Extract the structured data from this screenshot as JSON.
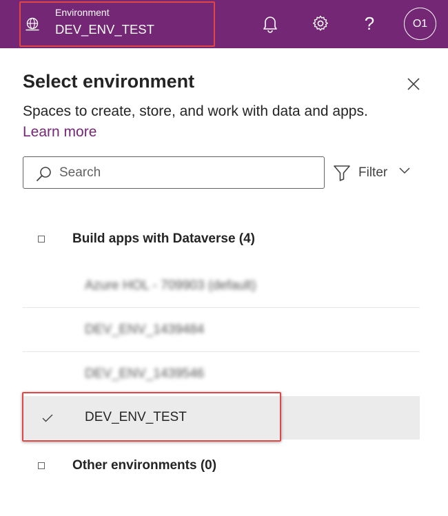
{
  "header": {
    "env_label": "Environment",
    "env_value": "DEV_ENV_TEST",
    "help_glyph": "?",
    "avatar_initials": "O1",
    "icons": [
      "globe-icon",
      "bell-icon",
      "gear-icon",
      "help-icon"
    ],
    "bg_color": "#742774"
  },
  "panel": {
    "title": "Select environment",
    "description": "Spaces to create, store, and work with data and apps.",
    "learn_more": "Learn more",
    "search_placeholder": "Search",
    "filter_label": "Filter"
  },
  "groups": [
    {
      "label": "Build apps with Dataverse (4)",
      "items": [
        {
          "name": "Azure HOL - 709903 (default)",
          "obscured": true,
          "selected": false
        },
        {
          "name": "DEV_ENV_1439484",
          "obscured": true,
          "selected": false
        },
        {
          "name": "DEV_ENV_1439546",
          "obscured": true,
          "selected": false
        },
        {
          "name": "DEV_ENV_TEST",
          "obscured": false,
          "selected": true
        }
      ]
    },
    {
      "label": "Other environments (0)",
      "items": []
    }
  ],
  "colors": {
    "accent": "#742774",
    "highlight_border": "#e04646",
    "selected_row_bg": "#ebebeb"
  }
}
